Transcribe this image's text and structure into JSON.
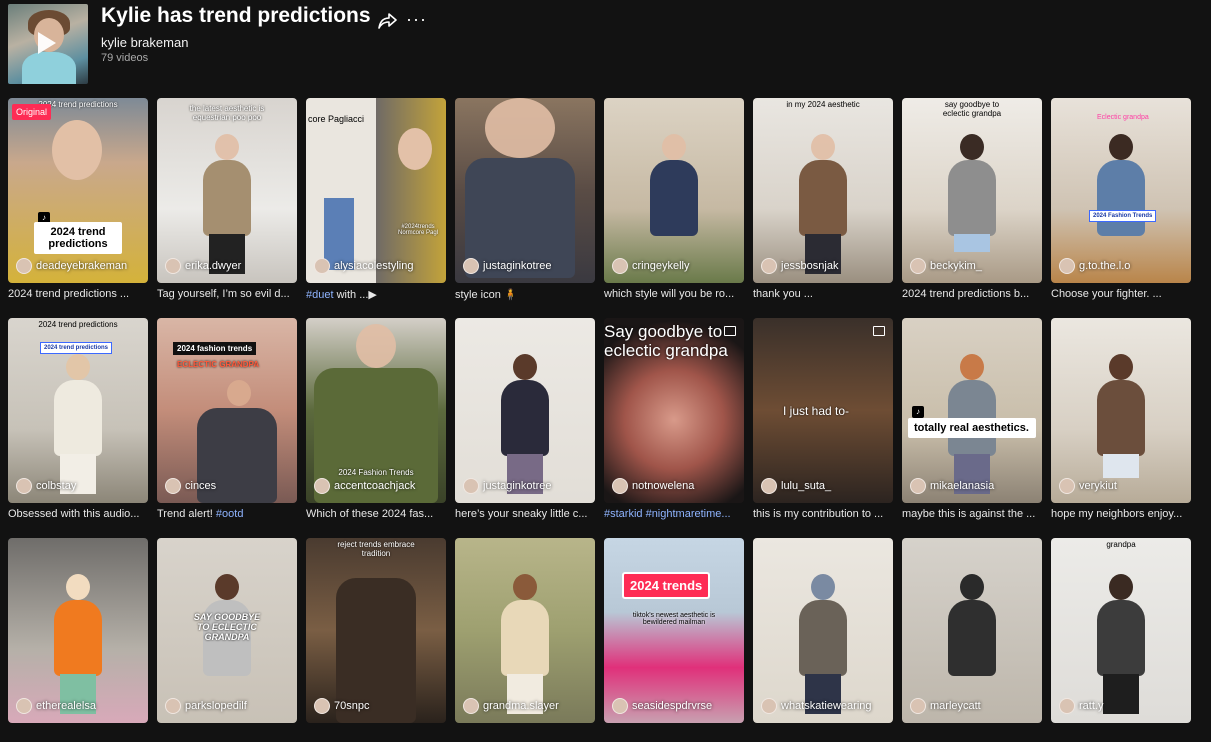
{
  "playlist": {
    "title": "Kylie has trend predictions",
    "author": "kylie brakeman",
    "video_count": "79 videos"
  },
  "icons": {
    "share": "share-icon",
    "more": "more-icon",
    "play": "play-icon"
  },
  "colors": {
    "background": "#121212",
    "badge": "#fe2c55",
    "hashtag": "#8fb4ff"
  },
  "rows": [
    [
      {
        "user": "deadeyebrakeman",
        "caption": "2024 trend predictions ...",
        "badge": "Original",
        "overlay_top": "2024 trend predictions",
        "label": "2024 trend predictions"
      },
      {
        "user": "erika.dwyer",
        "caption": "Tag yourself, I’m so evil d...",
        "overlay_top": "the latest aesthetic is equestrian poo poo"
      },
      {
        "user": "alysiacolestyling",
        "caption_tag": "#duet",
        "caption_rest": " with ...▶",
        "overlay_left": "core Pagliacci",
        "small_text": "#2024trends Normcore Pagl"
      },
      {
        "user": "justaginkotree",
        "caption": "style icon 🧍"
      },
      {
        "user": "cringeykelly",
        "caption": "which style will you be ro..."
      },
      {
        "user": "jessbosnjak",
        "caption": "thank you ...",
        "overlay_top": "in my 2024 aesthetic"
      },
      {
        "user": "beckykim_",
        "caption": "2024 trend predictions b...",
        "overlay_top": "say goodbye to eclectic grandpa"
      },
      {
        "user": "g.to.the.l.o",
        "caption": "Choose your fighter. ...",
        "overlay_top": "Eclectic grandpa",
        "label": "2024 Fashion Trends"
      }
    ],
    [
      {
        "user": "colbstay",
        "caption": "Obsessed with this audio...",
        "overlay_top": "2024 trend predictions",
        "label": "2024 trend predictions"
      },
      {
        "user": "cinces",
        "caption_rest": "Trend alert! ",
        "caption_tag": "#ootd",
        "label": "2024 fashion trends",
        "overlay_top": "ECLECTIC GRANDPA"
      },
      {
        "user": "accentcoachjack",
        "caption": "Which of these 2024 fas...",
        "small_text": "2024 Fashion Trends"
      },
      {
        "user": "justaginkotree",
        "caption": "here’s your sneaky little c..."
      },
      {
        "user": "notnowelena",
        "caption_tag": "#starkid #nightmaretime...",
        "overlay_top": "Say goodbye to eclectic grandpa"
      },
      {
        "user": "lulu_suta_",
        "caption": "this is my contribution to ...",
        "label": "I just had to-"
      },
      {
        "user": "mikaelanasia",
        "caption": "maybe this is against the ...",
        "label": "totally real aesthetics."
      },
      {
        "user": "verykiut",
        "caption": "hope my neighbors enjoy..."
      }
    ],
    [
      {
        "user": "etherealelsa",
        "caption": ""
      },
      {
        "user": "parkslopedilf",
        "caption": "",
        "label": "SAY GOODBYE TO ECLECTIC GRANDPA"
      },
      {
        "user": "70snpc",
        "caption": "",
        "overlay_top": "reject trends embrace tradition"
      },
      {
        "user": "grandma.slayer",
        "caption": ""
      },
      {
        "user": "seasidespdrvrse",
        "caption": "",
        "label": "2024 trends",
        "small_text": "tiktok's newest aesthetic is bewildered mailman"
      },
      {
        "user": "whatskatiewearing",
        "caption": ""
      },
      {
        "user": "marleycatt",
        "caption": ""
      },
      {
        "user": "ratt.y",
        "caption": "",
        "overlay_top": "grandpa"
      }
    ]
  ]
}
